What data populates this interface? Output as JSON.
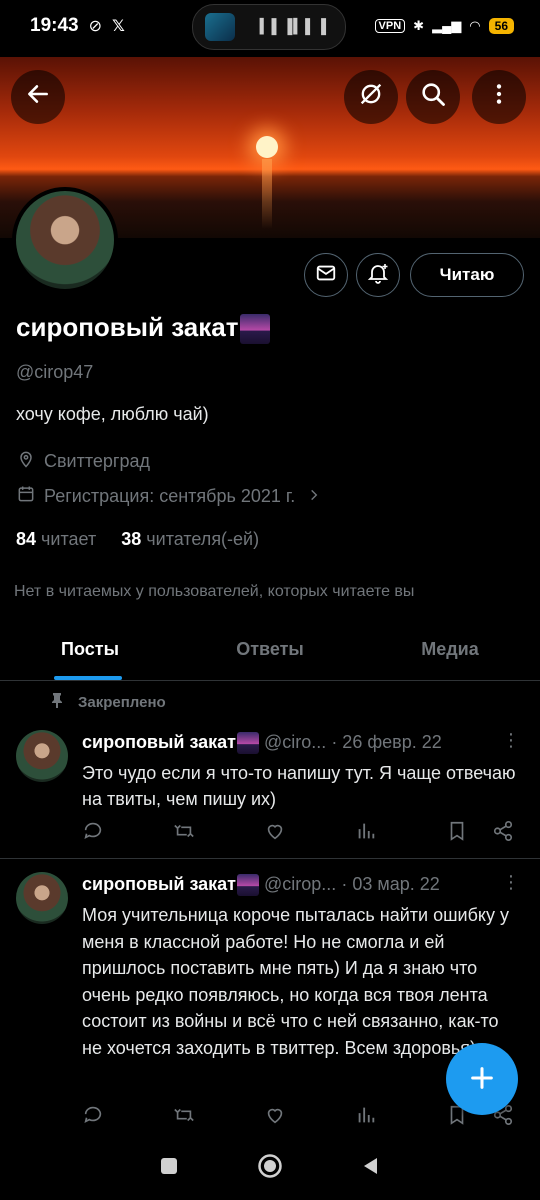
{
  "status_bar": {
    "time": "19:43",
    "vpn_label": "VPN",
    "battery": "56"
  },
  "profile": {
    "name": "сироповый закат",
    "handle": "@cirop47",
    "bio": "хочу кофе, люблю чай)",
    "location": "Свиттерград",
    "joined": "Регистрация: сентябрь 2021 г.",
    "following_count": "84",
    "following_label": "читает",
    "followers_count": "38",
    "followers_label": "читателя(-ей)",
    "follow_button": "Читаю",
    "notice": "Нет в читаемых у пользователей, которых читаете вы"
  },
  "tabs": [
    {
      "label": "Посты"
    },
    {
      "label": "Ответы"
    },
    {
      "label": "Медиа"
    }
  ],
  "pinned_label": "Закреплено",
  "tweets": [
    {
      "name": "сироповый закат",
      "handle": "@ciro...",
      "date": "· 26 февр. 22",
      "text": "Это чудо если я что-то напишу тут. Я чаще отвечаю на твиты, чем пишу их)"
    },
    {
      "name": "сироповый закат",
      "handle": "@cirop...",
      "date": "· 03 мар. 22",
      "text": "Моя учительница короче пыталась найти ошибку у меня в классной работе! Но не смогла и ей пришлось поставить мне пять) И да я знаю что очень редко появляюсь, но когда вся твоя лента состоит из войны и всё что с ней связанно, как-то не хочется заходить в твиттер. Всем здоровья)"
    }
  ],
  "icons": {
    "back": "←",
    "no-image": "⊘",
    "search": "⚲",
    "menu": "⋮",
    "mail": "✉",
    "bell": "🔔",
    "location": "⚲",
    "calendar": "▦",
    "pin": "📌",
    "reply": "💬",
    "retweet": "⇄",
    "like": "♡",
    "stats": "▮",
    "bookmark": "⊏",
    "share": "⟨",
    "compose": "+"
  }
}
